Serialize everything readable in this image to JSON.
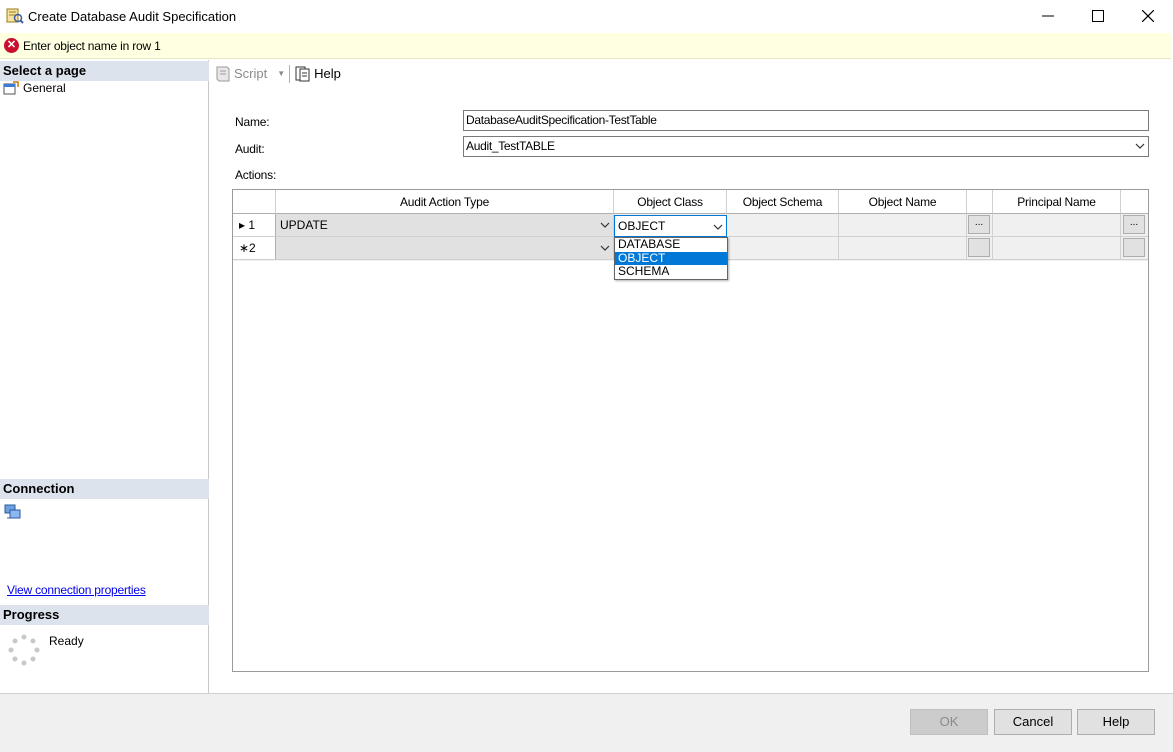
{
  "window": {
    "title": "Create Database Audit Specification",
    "minimize_glyph": "─",
    "maximize_glyph": "☐",
    "close_glyph": "✕"
  },
  "error": {
    "message": "Enter object name in row 1",
    "icon": "error-circle-icon",
    "color": "#c8102e"
  },
  "left": {
    "select_page_header": "Select a page",
    "pages": [
      {
        "label": "General",
        "icon": "page-icon"
      }
    ],
    "connection_header": "Connection",
    "connection_link": "View connection properties",
    "progress_header": "Progress",
    "progress_status": "Ready"
  },
  "toolbar": {
    "script_label": "Script",
    "help_label": "Help"
  },
  "form": {
    "name_label": "Name:",
    "name_value": "DatabaseAuditSpecification-TestTable",
    "audit_label": "Audit:",
    "audit_value": "Audit_TestTABLE",
    "actions_label": "Actions:"
  },
  "grid": {
    "columns": [
      "Audit Action Type",
      "Object Class",
      "Object Schema",
      "Object Name",
      "Principal Name"
    ],
    "ellipsis": "...",
    "rows": [
      {
        "marker": "▸ 1",
        "audit_action_type": "UPDATE",
        "object_class": "OBJECT",
        "object_schema": "",
        "object_name": "",
        "principal_name": ""
      },
      {
        "marker": "∗2",
        "audit_action_type": "",
        "object_class": "",
        "object_schema": "",
        "object_name": "",
        "principal_name": ""
      }
    ],
    "object_class_options": [
      "DATABASE",
      "OBJECT",
      "SCHEMA"
    ],
    "object_class_selected": "OBJECT",
    "selection_color": "#0078d7"
  },
  "buttons": {
    "ok": "OK",
    "cancel": "Cancel",
    "help": "Help"
  }
}
